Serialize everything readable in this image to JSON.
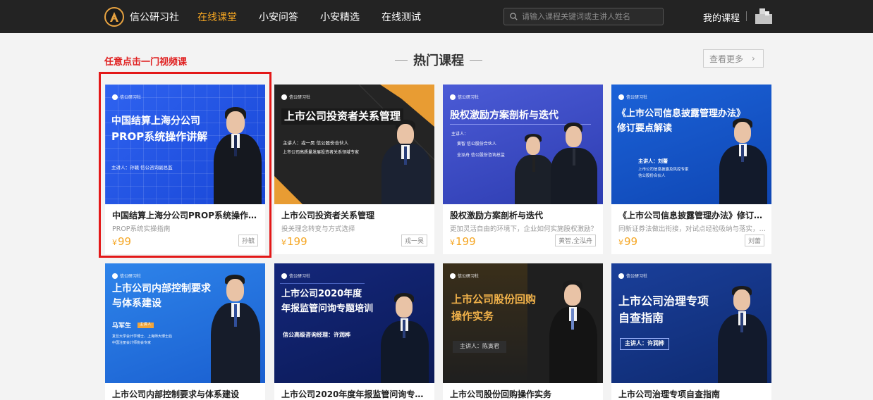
{
  "header": {
    "logo_text": "信公研习社",
    "nav": [
      {
        "label": "在线课堂",
        "active": true
      },
      {
        "label": "小安问答",
        "active": false
      },
      {
        "label": "小安精选",
        "active": false
      },
      {
        "label": "在线测试",
        "active": false
      }
    ],
    "search_placeholder": "请输入课程关键词或主讲人姓名",
    "my_course": "我的课程"
  },
  "section": {
    "hint": "任意点击一门视频课",
    "title": "热门课程",
    "more": "查看更多"
  },
  "colors": {
    "accent": "#f5a623",
    "nav_bg": "#232323",
    "highlight": "#e31818"
  },
  "courses": [
    {
      "title": "中国结算上海分公司PROP系统操作讲解",
      "subtitle": "PROP系统实操指南",
      "price": "99",
      "currency": "¥",
      "teacher": "孙毓",
      "cover": {
        "brand": "信公研习社",
        "line1": "中国结算上海分公司",
        "line2": "PROP系统操作讲解",
        "speaker": "主讲人：孙毓  信公咨询副总监"
      }
    },
    {
      "title": "上市公司投资者关系管理",
      "subtitle": "投关理念转变与方式选择",
      "price": "199",
      "currency": "¥",
      "teacher": "戎一昊",
      "cover": {
        "brand": "信公研习社",
        "line1": "上市公司投资者关系管理",
        "speaker": "主讲人：戎一昊  信公股份合伙人",
        "desc": "上市公司高质量发展投资者关系领域专家"
      }
    },
    {
      "title": "股权激励方案剖析与迭代",
      "subtitle": "更加灵活自由的环境下，企业如何实施股权激励？",
      "price": "199",
      "currency": "¥",
      "teacher": "黄智,全泓舟",
      "cover": {
        "brand": "信公研习社",
        "line1": "股权激励方案剖析与迭代",
        "speaker": "主讲人：",
        "s1": "黄智  信公股份合伙人",
        "s2": "全泓舟  信公股份咨询总监"
      }
    },
    {
      "title": "《上市公司信息披露管理办法》修订要点解读",
      "subtitle": "同新证券法做出衔接，对试点经验吸纳与落实，…",
      "price": "99",
      "currency": "¥",
      "teacher": "刘蕾",
      "cover": {
        "brand": "信公研习社",
        "line1": "《上市公司信息披露管理办法》",
        "line2": "修订要点解读",
        "speaker": "主讲人：刘蕾",
        "desc": "上市公司信息披露及风控专家",
        "desc2": "信公股份合伙人"
      }
    },
    {
      "title": "上市公司内部控制要求与体系建设",
      "cover": {
        "brand": "信公研习社",
        "line1": "上市公司内部控制要求",
        "line2": "与体系建设",
        "speaker": "马军生",
        "tag": "主讲人",
        "desc": "复旦大学会计学博士、上海师大博士后",
        "desc2": "中国注册会计师协会专家"
      }
    },
    {
      "title": "上市公司2020年度年报监管问询专题培训",
      "cover": {
        "brand": "信公研习社",
        "line1": "上市公司2020年度",
        "line2": "年报监管问询专题培训",
        "speaker": "信公高级咨询经理：许润桦"
      }
    },
    {
      "title": "上市公司股份回购操作实务",
      "cover": {
        "brand": "信公研习社",
        "line1": "上市公司股份回购",
        "line2": "操作实务",
        "speaker": "主讲人：陈寅君"
      }
    },
    {
      "title": "上市公司治理专项自查指南",
      "cover": {
        "brand": "信公研习社",
        "line1": "上市公司治理专项",
        "line2": "自查指南",
        "speaker": "主讲人：许润桦"
      }
    }
  ]
}
